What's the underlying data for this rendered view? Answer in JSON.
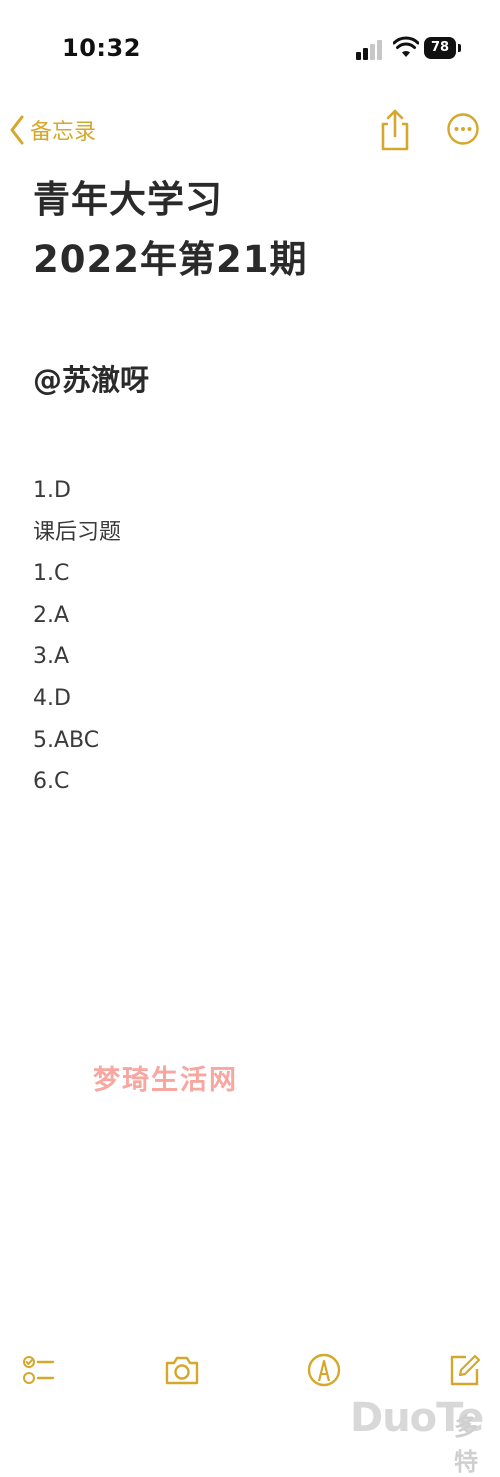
{
  "status_bar": {
    "time": "10:32",
    "battery": "78"
  },
  "nav": {
    "back_label": "备忘录"
  },
  "note": {
    "title_lines": [
      "青年大学习",
      "2022年第21期"
    ],
    "author": "@苏澈呀",
    "answers": [
      "1.D",
      "课后习题",
      "1.C",
      "2.A",
      "3.A",
      "4.D",
      "5.ABC",
      "6.C"
    ]
  },
  "watermark": {
    "text": "梦琦生活网",
    "logo_brand": "DuoTe",
    "logo_cn": "多特"
  },
  "colors": {
    "accent": "#d5a82c",
    "text": "#2a2a2a",
    "watermark": "#f7a6a0"
  },
  "icons": [
    "chevron-left-icon",
    "share-icon",
    "more-icon",
    "checklist-icon",
    "camera-icon",
    "markup-icon",
    "compose-icon"
  ]
}
